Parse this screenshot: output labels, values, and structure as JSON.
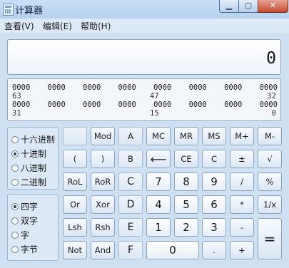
{
  "window": {
    "title": "计算器"
  },
  "menu": [
    "查看(V)",
    "编辑(E)",
    "帮助(H)"
  ],
  "display": {
    "value": "0"
  },
  "bits": {
    "row1": [
      "0000",
      "0000",
      "0000",
      "0000",
      "0000",
      "0000",
      "0000",
      "0000"
    ],
    "row1_labels": {
      "left": "63",
      "mid": "47",
      "right": "32"
    },
    "row2": [
      "0000",
      "0000",
      "0000",
      "0000",
      "0000",
      "0000",
      "0000",
      "0000"
    ],
    "row2_labels": {
      "left": "31",
      "mid": "15",
      "right": "0"
    }
  },
  "base_modes": [
    {
      "label": "十六进制",
      "selected": false
    },
    {
      "label": "十进制",
      "selected": true
    },
    {
      "label": "八进制",
      "selected": false
    },
    {
      "label": "二进制",
      "selected": false
    }
  ],
  "word_sizes": [
    {
      "label": "四字",
      "selected": true
    },
    {
      "label": "双字",
      "selected": false
    },
    {
      "label": "字",
      "selected": false
    },
    {
      "label": "字节",
      "selected": false
    }
  ],
  "keys": {
    "blank": "",
    "mod": "Mod",
    "a": "A",
    "mc": "MC",
    "mr": "MR",
    "ms": "MS",
    "mplus": "M+",
    "mminus": "M-",
    "lparen": "(",
    "rparen": ")",
    "b": "B",
    "back": "⟵",
    "ce": "CE",
    "c": "C",
    "plusminus": "±",
    "sqrt": "√",
    "rol": "RoL",
    "ror": "RoR",
    "c_hex": "C",
    "seven": "7",
    "eight": "8",
    "nine": "9",
    "div": "/",
    "pct": "%",
    "or": "Or",
    "xor": "Xor",
    "d": "D",
    "four": "4",
    "five": "5",
    "six": "6",
    "mul": "*",
    "recip": "1/x",
    "lsh": "Lsh",
    "rsh": "Rsh",
    "e": "E",
    "one": "1",
    "two": "2",
    "three": "3",
    "sub": "-",
    "eq": "=",
    "not": "Not",
    "and": "And",
    "f": "F",
    "zero": "0",
    "dot": ".",
    "add": "+"
  }
}
